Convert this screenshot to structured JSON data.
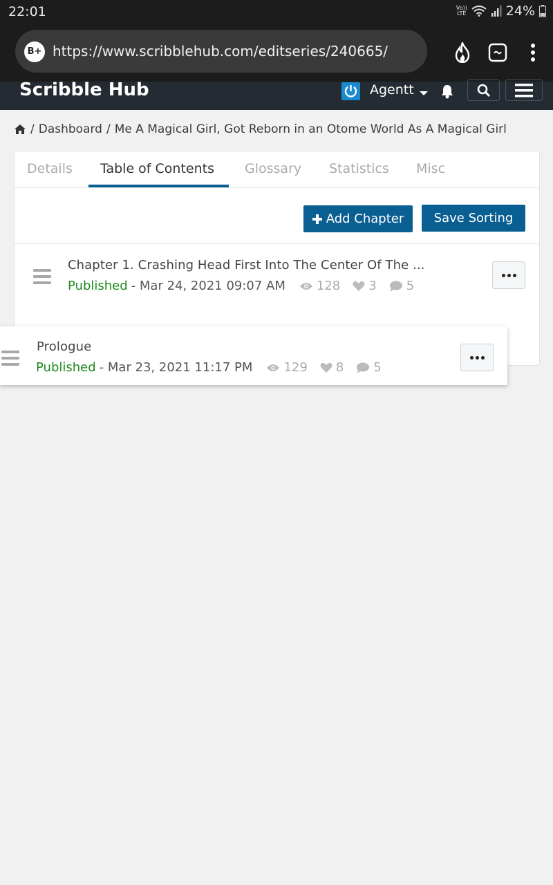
{
  "status": {
    "time": "22:01",
    "volte": "Vo)) LTE",
    "battery": "24%"
  },
  "browser": {
    "badge": "B+",
    "url": "https://www.scribblehub.com/editseries/240665/"
  },
  "header": {
    "brand": "Scribble Hub",
    "username": "Agentt"
  },
  "breadcrumb": {
    "dashboard": "Dashboard",
    "series": "Me A Magical Girl, Got Reborn in an Otome World As A Magical Girl",
    "sep": "/"
  },
  "tabs": [
    "Details",
    "Table of Contents",
    "Glossary",
    "Statistics",
    "Misc"
  ],
  "actions": {
    "add_chapter": "Add Chapter",
    "save_sorting": "Save Sorting"
  },
  "chapters": [
    {
      "title": "Chapter 1. Crashing Head First Into The Center Of The ...",
      "status": "Published",
      "date": "- Mar 24, 2021 09:07 AM",
      "views": "128",
      "likes": "3",
      "comments": "5"
    },
    {
      "title": "Prologue",
      "status": "Published",
      "date": "- Mar 23, 2021 11:17 PM",
      "views": "129",
      "likes": "8",
      "comments": "5"
    }
  ],
  "colors": {
    "accent": "#0a5f92",
    "published": "#1e8a1e",
    "header_bg": "#242b33"
  }
}
